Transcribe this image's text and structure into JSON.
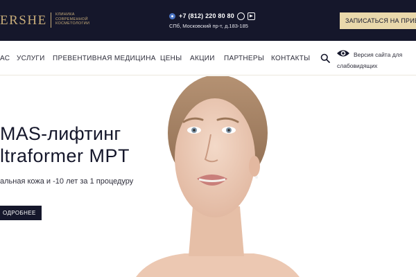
{
  "header": {
    "logo_text": "ERSHE",
    "logo_subtitle": "КЛИНИКА СОВРЕМЕННОЙ КОСМЕТОЛОГИИ",
    "phone": "+7 (812) 220 80 80",
    "address": "СПб, Московский пр-т, д.183-185",
    "cta_label": "ЗАПИСАТЬСЯ НА ПРИЕМ",
    "icons": [
      "phone-icon",
      "whatsapp-icon",
      "telegram-icon"
    ]
  },
  "nav": {
    "items": [
      "АС",
      "УСЛУГИ",
      "ПРЕВЕНТИВНАЯ МЕДИЦИНА",
      "ЦЕНЫ",
      "АКЦИИ",
      "ПАРТНЕРЫ",
      "КОНТАКТЫ"
    ],
    "accessibility_label": "Версия сайта для слабовидящих",
    "icons": [
      "search-icon",
      "eye-icon"
    ]
  },
  "hero": {
    "title_line1": "MAS-лифтинг",
    "title_line2": "ltraformer MPT",
    "subtitle": "альная кожа и -10 лет за 1 процедуру",
    "button_label": "ОДРОБНЕЕ"
  },
  "colors": {
    "topbar": "#15172b",
    "gold": "#c8ad7a",
    "cta": "#e9d8ab",
    "text": "#2d2d3a"
  }
}
